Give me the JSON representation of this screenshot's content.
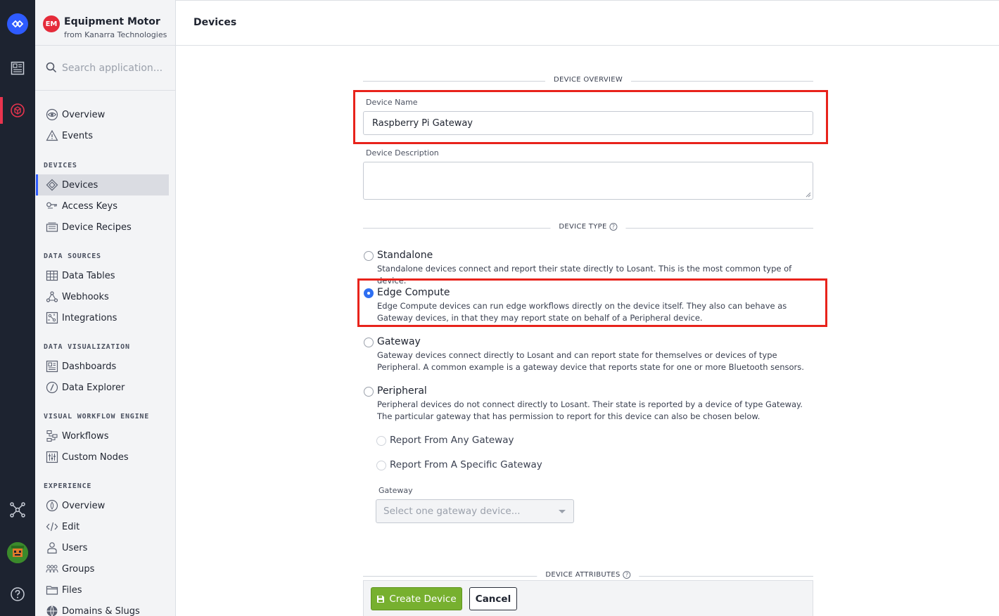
{
  "app": {
    "badge": "EM",
    "name": "Equipment Motor",
    "org": "from Kanarra Technologies"
  },
  "search": {
    "placeholder": "Search application..."
  },
  "sidebar": {
    "top_items": [
      {
        "label": "Overview",
        "icon": "eye-icon"
      },
      {
        "label": "Events",
        "icon": "warning-triangle-icon"
      }
    ],
    "sections": [
      {
        "title": "DEVICES",
        "items": [
          {
            "label": "Devices",
            "icon": "device-diamond-icon",
            "active": true
          },
          {
            "label": "Access Keys",
            "icon": "key-icon"
          },
          {
            "label": "Device Recipes",
            "icon": "recipe-icon"
          }
        ]
      },
      {
        "title": "DATA SOURCES",
        "items": [
          {
            "label": "Data Tables",
            "icon": "table-icon"
          },
          {
            "label": "Webhooks",
            "icon": "webhook-icon"
          },
          {
            "label": "Integrations",
            "icon": "integrations-icon"
          }
        ]
      },
      {
        "title": "DATA VISUALIZATION",
        "items": [
          {
            "label": "Dashboards",
            "icon": "dashboard-icon"
          },
          {
            "label": "Data Explorer",
            "icon": "compass-icon"
          }
        ]
      },
      {
        "title": "VISUAL WORKFLOW ENGINE",
        "items": [
          {
            "label": "Workflows",
            "icon": "workflow-icon"
          },
          {
            "label": "Custom Nodes",
            "icon": "custom-nodes-icon"
          }
        ]
      },
      {
        "title": "EXPERIENCE",
        "items": [
          {
            "label": "Overview",
            "icon": "experience-overview-icon"
          },
          {
            "label": "Edit",
            "icon": "code-icon"
          },
          {
            "label": "Users",
            "icon": "user-icon"
          },
          {
            "label": "Groups",
            "icon": "groups-icon"
          },
          {
            "label": "Files",
            "icon": "folder-icon"
          },
          {
            "label": "Domains & Slugs",
            "icon": "globe-icon"
          }
        ]
      }
    ]
  },
  "page": {
    "title": "Devices"
  },
  "form": {
    "overview_heading": "DEVICE OVERVIEW",
    "name_label": "Device Name",
    "name_value": "Raspberry Pi Gateway",
    "description_label": "Device Description",
    "type_heading": "DEVICE TYPE",
    "types": [
      {
        "title": "Standalone",
        "desc": "Standalone devices connect and report their state directly to Losant. This is the most common type of device.",
        "selected": false
      },
      {
        "title": "Edge Compute",
        "desc": "Edge Compute devices can run edge workflows directly on the device itself. They also can behave as Gateway devices, in that they may report state on behalf of a Peripheral device.",
        "selected": true
      },
      {
        "title": "Gateway",
        "desc": "Gateway devices connect directly to Losant and can report state for themselves or devices of type Peripheral. A common example is a gateway device that reports state for one or more Bluetooth sensors.",
        "selected": false
      },
      {
        "title": "Peripheral",
        "desc": "Peripheral devices do not connect directly to Losant. Their state is reported by a device of type Gateway. The particular gateway that has permission to report for this device can also be chosen below.",
        "selected": false
      }
    ],
    "report_any": "Report From Any Gateway",
    "report_specific": "Report From A Specific Gateway",
    "gateway_label": "Gateway",
    "gateway_placeholder": "Select one gateway device...",
    "attributes_heading": "DEVICE ATTRIBUTES"
  },
  "actions": {
    "create": "Create Device",
    "cancel": "Cancel"
  },
  "colors": {
    "accent": "#2e5bff",
    "highlight": "#e8231b",
    "create": "#77b02f",
    "rail": "#1d2330"
  }
}
